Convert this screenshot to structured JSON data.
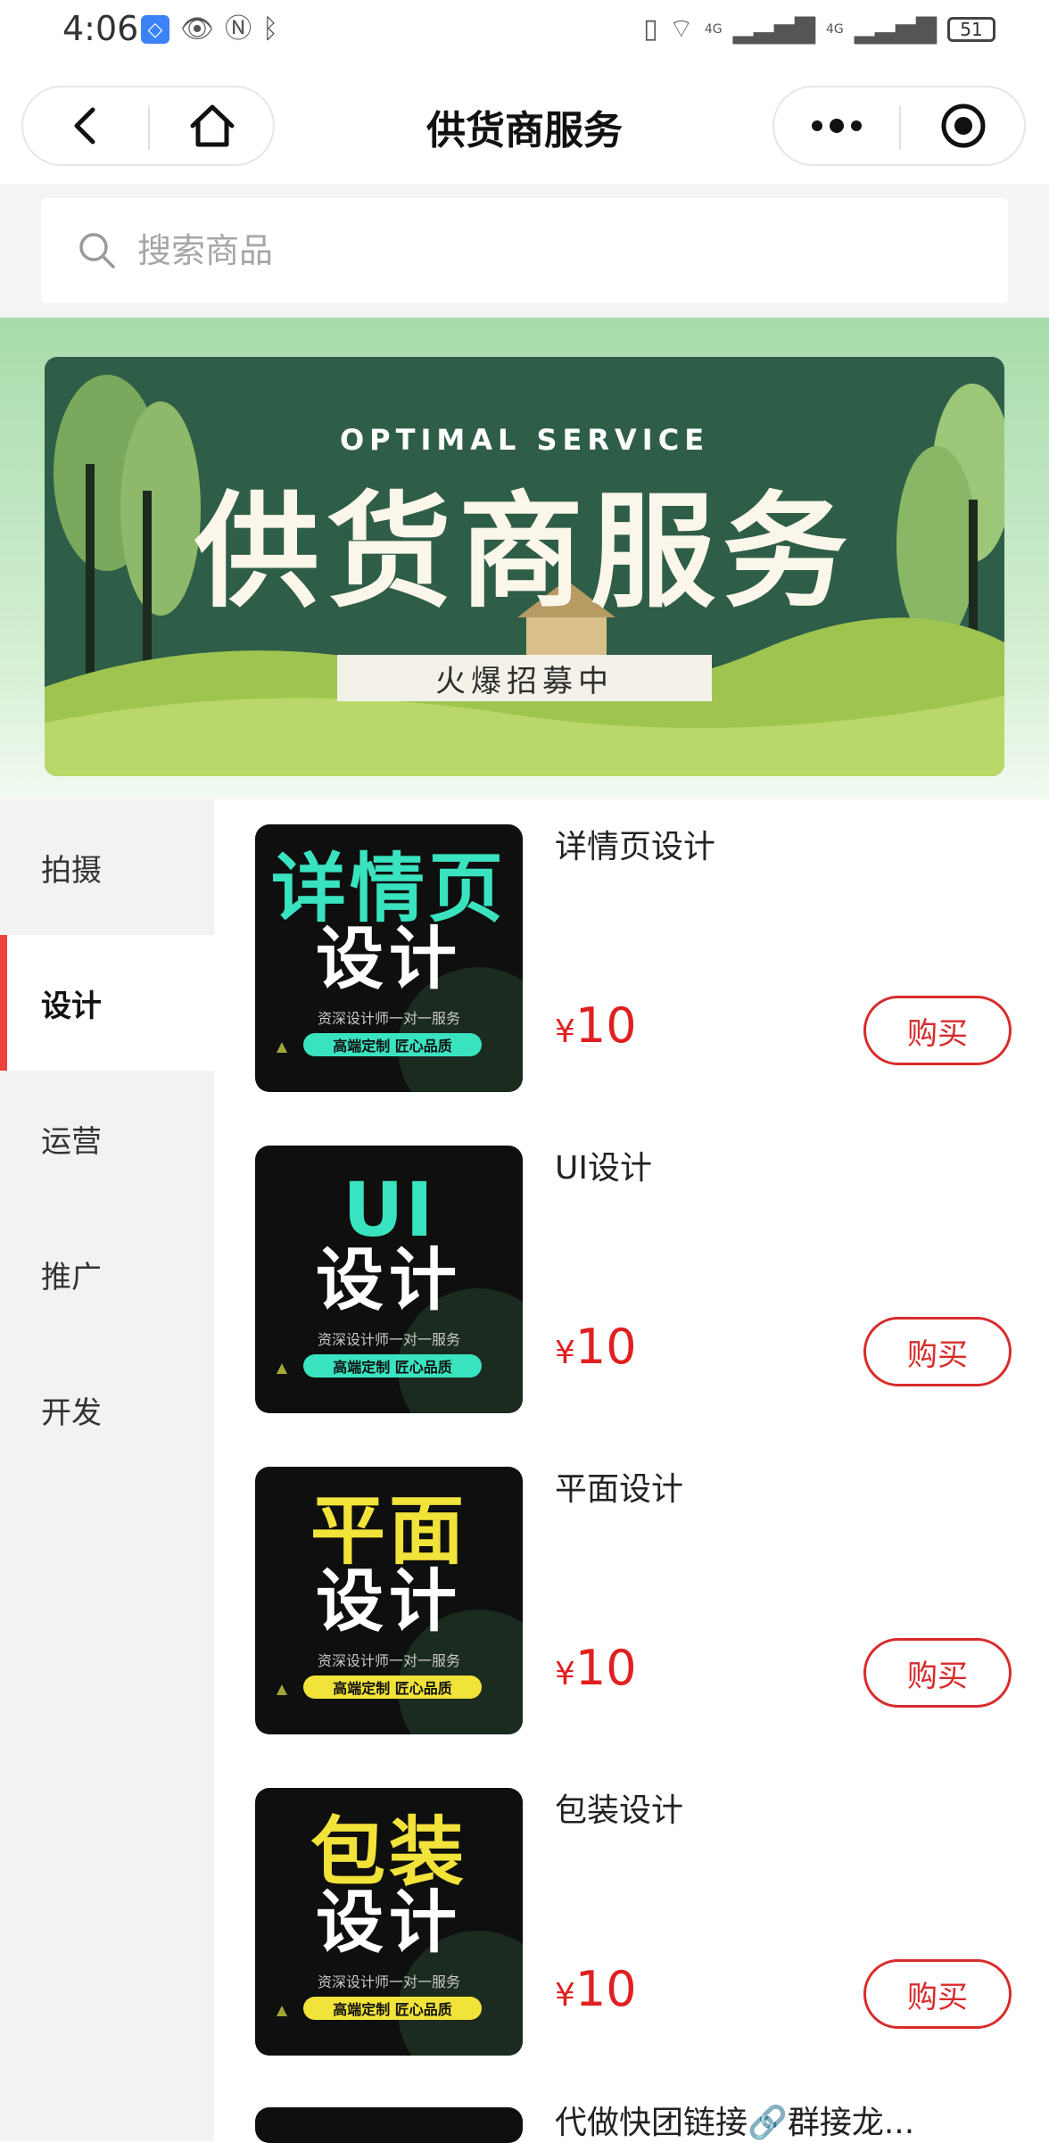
{
  "status_bar": {
    "time": "4:06",
    "network_label_1": "4G",
    "network_label_2": "4G",
    "battery": "51"
  },
  "nav": {
    "title": "供货商服务"
  },
  "search": {
    "placeholder": "搜索商品"
  },
  "banner": {
    "subtitle": "OPTIMAL  SERVICE",
    "title": "供货商服务",
    "tag": "火爆招募中"
  },
  "sidebar": {
    "items": [
      {
        "label": "拍摄"
      },
      {
        "label": "设计"
      },
      {
        "label": "运营"
      },
      {
        "label": "推广"
      },
      {
        "label": "开发"
      }
    ],
    "active_index": 1
  },
  "products": [
    {
      "name": "详情页设计",
      "price_currency": "¥",
      "price": "10",
      "buy_label": "购买",
      "thumb": {
        "line1": "详情页",
        "line2": "设计",
        "line3": "资深设计师一对一服务",
        "pill": "高端定制  匠心品质",
        "accent": "#39e3c0"
      }
    },
    {
      "name": "UI设计",
      "price_currency": "¥",
      "price": "10",
      "buy_label": "购买",
      "thumb": {
        "line1": "UI",
        "line2": "设计",
        "line3": "资深设计师一对一服务",
        "pill": "高端定制  匠心品质",
        "accent": "#39e3c0"
      }
    },
    {
      "name": "平面设计",
      "price_currency": "¥",
      "price": "10",
      "buy_label": "购买",
      "thumb": {
        "line1": "平面",
        "line2": "设计",
        "line3": "资深设计师一对一服务",
        "pill": "高端定制  匠心品质",
        "accent": "#f2e33a"
      }
    },
    {
      "name": "包装设计",
      "price_currency": "¥",
      "price": "10",
      "buy_label": "购买",
      "thumb": {
        "line1": "包装",
        "line2": "设计",
        "line3": "资深设计师一对一服务",
        "pill": "高端定制  匠心品质",
        "accent": "#f2e33a"
      }
    },
    {
      "name": "代做快团链接🔗群接龙...",
      "price_currency": "",
      "price": "",
      "buy_label": "",
      "thumb": {
        "line1": "",
        "line2": "",
        "line3": "",
        "pill": "",
        "accent": "#39e3c0"
      }
    }
  ],
  "colors": {
    "price_red": "#e02020",
    "active_indicator": "#f04040",
    "banner_green": "#2f5e48"
  }
}
